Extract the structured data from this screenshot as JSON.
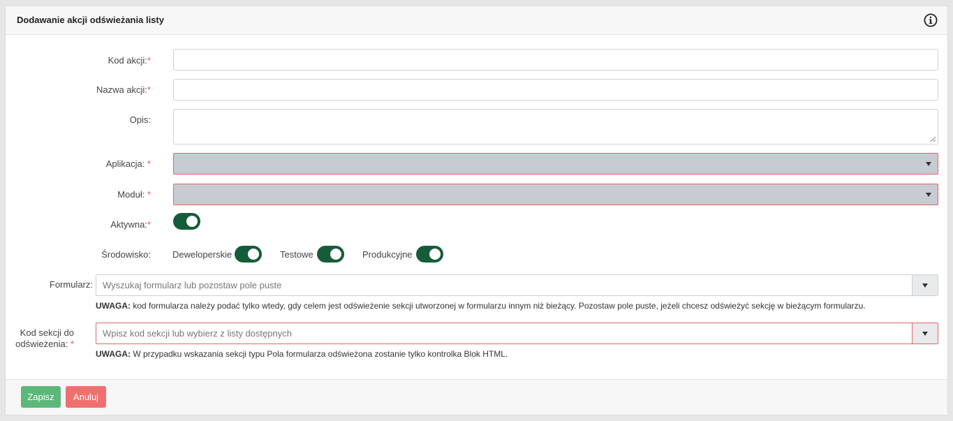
{
  "panel": {
    "title": "Dodawanie akcji odświeżania listy",
    "info_icon": "info-circle-icon"
  },
  "fields": {
    "kod_akcji": {
      "label": "Kod akcji:",
      "required_mark": "*",
      "value": ""
    },
    "nazwa_akcji": {
      "label": "Nazwa akcji:",
      "required_mark": "*",
      "value": ""
    },
    "opis": {
      "label": "Opis:",
      "value": ""
    },
    "aplikacja": {
      "label": "Aplikacja: ",
      "required_mark": "*",
      "value": ""
    },
    "modul": {
      "label": "Moduł: ",
      "required_mark": "*",
      "value": ""
    },
    "aktywna": {
      "label": "Aktywna:",
      "required_mark": "*",
      "checked": true
    },
    "srodowisko": {
      "label": "Środowisko:",
      "options": [
        {
          "label": "Deweloperskie",
          "checked": true
        },
        {
          "label": "Testowe",
          "checked": true
        },
        {
          "label": "Produkcyjne",
          "checked": true
        }
      ]
    },
    "formularz": {
      "label": "Formularz:",
      "placeholder": "Wyszukaj formularz lub pozostaw pole puste",
      "note_strong": "UWAGA:",
      "note_text": " kod formularza należy podać tylko wtedy, gdy celem jest odświeżenie sekcji utworzonej w formularzu innym niż bieżący. Pozostaw pole puste, jeżeli chcesz odświeżyć sekcję w bieżącym formularzu."
    },
    "kod_sekcji": {
      "label_line1": "Kod sekcji do",
      "label_line2": "odświeżenia: ",
      "required_mark": "*",
      "placeholder": "Wpisz kod sekcji lub wybierz z listy dostępnych",
      "note_strong": "UWAGA:",
      "note_text": " W przypadku wskazania sekcji typu Pola formularza odświeżona zostanie tylko kontrolka Blok HTML."
    }
  },
  "footer": {
    "save_label": "Zapisz",
    "cancel_label": "Anuluj"
  },
  "colors": {
    "toggle_on": "#165c3a",
    "save_button": "#5cb87a",
    "cancel_button": "#f07070",
    "error_border": "#e06666",
    "required_mark": "#e05555"
  }
}
